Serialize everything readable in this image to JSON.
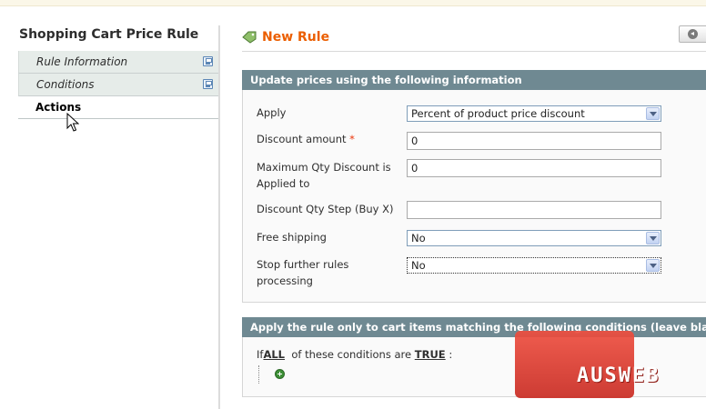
{
  "sidebar": {
    "title": "Shopping Cart Price Rule",
    "tabs": [
      {
        "label": "Rule Information",
        "state": "inactive"
      },
      {
        "label": "Conditions",
        "state": "inactive"
      },
      {
        "label": "Actions",
        "state": "active"
      }
    ]
  },
  "header": {
    "title": "New Rule"
  },
  "actions_section": {
    "title": "Update prices using the following information",
    "fields": {
      "apply": {
        "label": "Apply",
        "value": "Percent of product price discount"
      },
      "discount_amount": {
        "label": "Discount amount",
        "required_mark": "*",
        "value": "0"
      },
      "max_qty": {
        "label": "Maximum Qty Discount is Applied to",
        "value": "0"
      },
      "qty_step": {
        "label": "Discount Qty Step (Buy X)",
        "value": ""
      },
      "free_shipping": {
        "label": "Free shipping",
        "value": "No"
      },
      "stop_rules": {
        "label": "Stop further rules processing",
        "value": "No"
      }
    }
  },
  "conditions_section": {
    "title": "Apply the rule only to cart items matching the following conditions (leave blank for all items)",
    "prefix": "If",
    "aggregator": "ALL",
    "middle": "of these conditions are",
    "value": "TRUE",
    "suffix": ":"
  },
  "watermark": {
    "text": "AUSWEB"
  },
  "colors": {
    "accent": "#eb5e00",
    "section_header": "#6f8992",
    "tab_inactive": "#e6ece9"
  }
}
